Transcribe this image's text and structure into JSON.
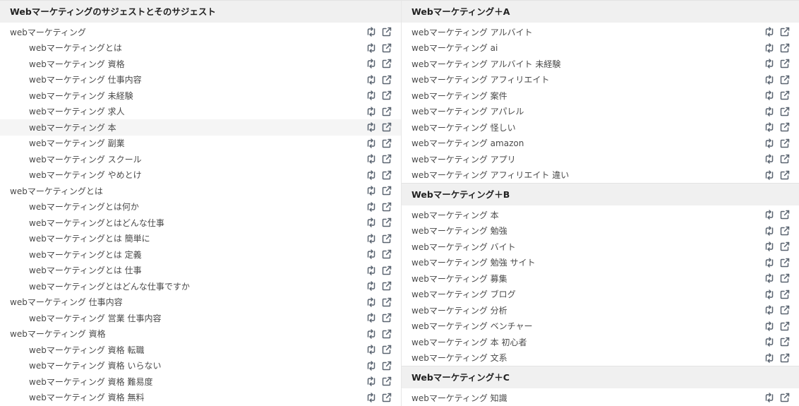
{
  "left": {
    "title": "Webマーケティングのサジェストとそのサジェスト",
    "rows": [
      {
        "text": "webマーケティング",
        "indent": false
      },
      {
        "text": "webマーケティングとは",
        "indent": true
      },
      {
        "text": "webマーケティング 資格",
        "indent": true
      },
      {
        "text": "webマーケティング 仕事内容",
        "indent": true
      },
      {
        "text": "webマーケティング 未経験",
        "indent": true
      },
      {
        "text": "webマーケティング 求人",
        "indent": true
      },
      {
        "text": "webマーケティング 本",
        "indent": true,
        "highlight": true
      },
      {
        "text": "webマーケティング 副業",
        "indent": true
      },
      {
        "text": "webマーケティング スクール",
        "indent": true
      },
      {
        "text": "webマーケティング やめとけ",
        "indent": true
      },
      {
        "text": "webマーケティングとは",
        "indent": false
      },
      {
        "text": "webマーケティングとは何か",
        "indent": true
      },
      {
        "text": "webマーケティングとはどんな仕事",
        "indent": true
      },
      {
        "text": "webマーケティングとは 簡単に",
        "indent": true
      },
      {
        "text": "webマーケティングとは 定義",
        "indent": true
      },
      {
        "text": "webマーケティングとは 仕事",
        "indent": true
      },
      {
        "text": "webマーケティングとはどんな仕事ですか",
        "indent": true
      },
      {
        "text": "webマーケティング 仕事内容",
        "indent": false
      },
      {
        "text": "webマーケティング 営業 仕事内容",
        "indent": true
      },
      {
        "text": "webマーケティング 資格",
        "indent": false
      },
      {
        "text": "webマーケティング 資格 転職",
        "indent": true
      },
      {
        "text": "webマーケティング 資格 いらない",
        "indent": true
      },
      {
        "text": "webマーケティング 資格 難易度",
        "indent": true
      },
      {
        "text": "webマーケティング 資格 無料",
        "indent": true
      }
    ]
  },
  "right": {
    "sections": [
      {
        "title": "Webマーケティング＋A",
        "rows": [
          "webマーケティング アルバイト",
          "webマーケティング ai",
          "webマーケティング アルバイト 未経験",
          "webマーケティング アフィリエイト",
          "webマーケティング 案件",
          "webマーケティング アパレル",
          "webマーケティング 怪しい",
          "webマーケティング amazon",
          "webマーケティング アプリ",
          "webマーケティング アフィリエイト 違い"
        ]
      },
      {
        "title": "Webマーケティング＋B",
        "rows": [
          "webマーケティング 本",
          "webマーケティング 勉強",
          "webマーケティング バイト",
          "webマーケティング 勉強 サイト",
          "webマーケティング 募集",
          "webマーケティング ブログ",
          "webマーケティング 分析",
          "webマーケティング ベンチャー",
          "webマーケティング 本 初心者",
          "webマーケティング 文系"
        ]
      },
      {
        "title": "Webマーケティング＋C",
        "rows": [
          "webマーケティング 知識"
        ]
      }
    ]
  },
  "icons": {
    "retweet": "repeat-icon",
    "external": "external-link-icon",
    "color": "#5a6470"
  }
}
